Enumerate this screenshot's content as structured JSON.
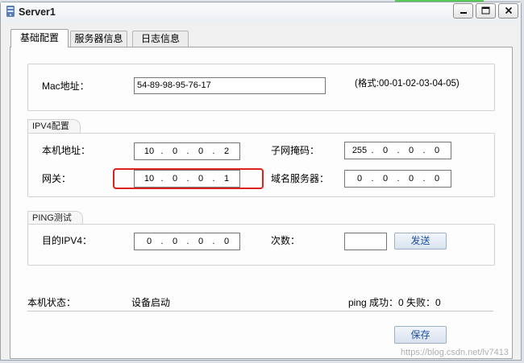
{
  "window": {
    "title": "Server1",
    "icon": "server-icon",
    "controls": [
      "minimize-icon",
      "maximize-icon",
      "close-icon"
    ]
  },
  "tabs": [
    {
      "label": "基础配置",
      "active": true
    },
    {
      "label": "服务器信息",
      "active": false
    },
    {
      "label": "日志信息",
      "active": false
    }
  ],
  "mac": {
    "label": "Mac地址：",
    "value": "54-89-98-95-76-17",
    "format_hint": "(格式:00-01-02-03-04-05)"
  },
  "ipv4": {
    "legend": "IPV4配置",
    "local_address": {
      "label": "本机地址：",
      "octets": [
        "10",
        "0",
        "0",
        "2"
      ]
    },
    "subnet_mask": {
      "label": "子网掩码：",
      "octets": [
        "255",
        "0",
        "0",
        "0"
      ]
    },
    "gateway": {
      "label": "网关：",
      "octets": [
        "10",
        "0",
        "0",
        "1"
      ]
    },
    "dns_server": {
      "label": "域名服务器：",
      "octets": [
        "0",
        "0",
        "0",
        "0"
      ]
    }
  },
  "ping": {
    "legend": "PING测试",
    "destination": {
      "label": "目的IPV4：",
      "octets": [
        "0",
        "0",
        "0",
        "0"
      ]
    },
    "count": {
      "label": "次数：",
      "value": ""
    },
    "send_label": "发送"
  },
  "status": {
    "label": "本机状态：",
    "value": "设备启动",
    "ping_result": "ping 成功：0 失败：0"
  },
  "save_label": "保存",
  "watermark": "https://blog.csdn.net/lv7413",
  "colors": {
    "highlight": "#e0201a",
    "button_text": "#1b4fa0",
    "window_bg": "#f0f0f0",
    "panel_bg": "#fdfdfd"
  }
}
